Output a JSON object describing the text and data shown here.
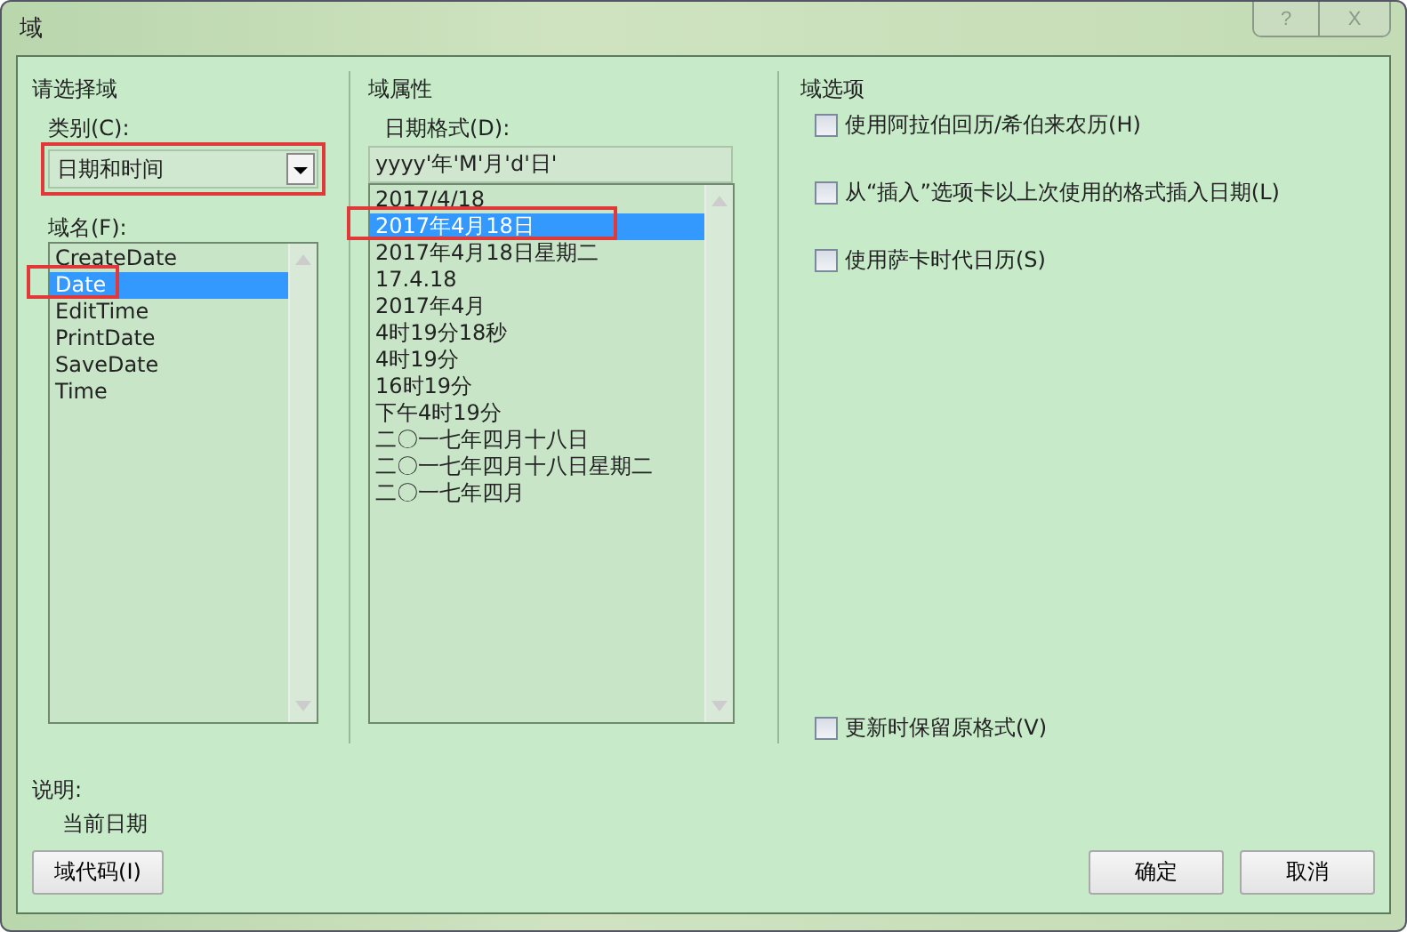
{
  "window": {
    "title": "域",
    "help_button": "?",
    "close_button": "X"
  },
  "select_field": {
    "heading": "请选择域",
    "category_label": "类别(C):",
    "category_value": "日期和时间",
    "category_highlighted": true,
    "fieldname_label": "域名(F):",
    "fieldnames": [
      {
        "label": "CreateDate",
        "selected": false,
        "highlighted": false
      },
      {
        "label": "Date",
        "selected": true,
        "highlighted": true
      },
      {
        "label": "EditTime",
        "selected": false,
        "highlighted": false
      },
      {
        "label": "PrintDate",
        "selected": false,
        "highlighted": false
      },
      {
        "label": "SaveDate",
        "selected": false,
        "highlighted": false
      },
      {
        "label": "Time",
        "selected": false,
        "highlighted": false
      }
    ]
  },
  "field_properties": {
    "heading": "域属性",
    "format_label": "日期格式(D):",
    "format_value": "yyyy'年'M'月'd'日'",
    "formats": [
      {
        "label": "2017/4/18",
        "selected": false,
        "highlighted": false
      },
      {
        "label": "2017年4月18日",
        "selected": true,
        "highlighted": true
      },
      {
        "label": "2017年4月18日星期二",
        "selected": false,
        "highlighted": false
      },
      {
        "label": "17.4.18",
        "selected": false,
        "highlighted": false
      },
      {
        "label": "2017年4月",
        "selected": false,
        "highlighted": false
      },
      {
        "label": "4时19分18秒",
        "selected": false,
        "highlighted": false
      },
      {
        "label": "4时19分",
        "selected": false,
        "highlighted": false
      },
      {
        "label": "16时19分",
        "selected": false,
        "highlighted": false
      },
      {
        "label": "下午4时19分",
        "selected": false,
        "highlighted": false
      },
      {
        "label": "二〇一七年四月十八日",
        "selected": false,
        "highlighted": false
      },
      {
        "label": "二〇一七年四月十八日星期二",
        "selected": false,
        "highlighted": false
      },
      {
        "label": "二〇一七年四月",
        "selected": false,
        "highlighted": false
      }
    ]
  },
  "field_options": {
    "heading": "域选项",
    "options": [
      {
        "label": "使用阿拉伯回历/希伯来农历(H)",
        "checked": false
      },
      {
        "label": "从“插入”选项卡以上次使用的格式插入日期(L)",
        "checked": false
      },
      {
        "label": "使用萨卡时代日历(S)",
        "checked": false
      }
    ],
    "bottom_option": {
      "label": "更新时保留原格式(V)",
      "checked": false
    }
  },
  "description": {
    "label": "说明:",
    "text": "当前日期"
  },
  "buttons": {
    "field_codes": "域代码(I)",
    "ok": "确定",
    "cancel": "取消"
  }
}
